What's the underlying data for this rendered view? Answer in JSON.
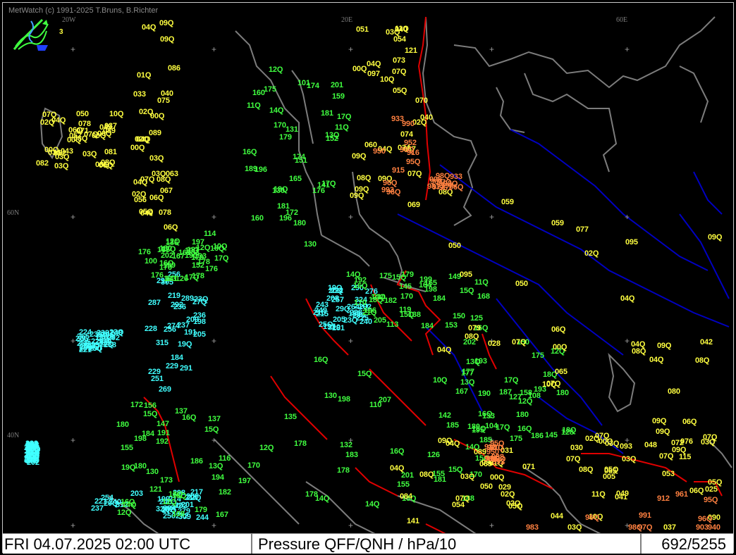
{
  "app": {
    "copyright": "MetWatch  (c) 1991-2025 T.Bruns, B.Richter",
    "logo_number": "3",
    "logo_icon": "metwatch-logo-icon"
  },
  "status": {
    "datetime": "FRI 04.07.2025 02:00 UTC",
    "product": "Pressure QFF/QNH / hPa/10",
    "count": "692/5255"
  },
  "grid_labels": [
    "20W",
    "20E",
    "60E",
    "60N",
    "40N"
  ],
  "colors": {
    "cyan": "#40ffff",
    "green": "#40ff40",
    "yellow": "#ffff40",
    "orange": "#ff8040",
    "coast": "#7c7c7c",
    "border": "#e00000",
    "river": "#0000c0",
    "statusbar": "#ffffff"
  },
  "stations": {
    "cyan": [
      "289",
      "318",
      "324",
      "314",
      "312",
      "291",
      "286",
      "285",
      "290",
      "309",
      "305",
      "297",
      "292",
      "250",
      "272",
      "274",
      "268",
      "257",
      "236",
      "240",
      "251",
      "235",
      "222",
      "202",
      "201",
      "219",
      "221",
      "210",
      "227",
      "237",
      "236",
      "238",
      "249",
      "254",
      "250",
      "256",
      "265",
      "264",
      "263",
      "262",
      "269",
      "270",
      "276",
      "268",
      "279",
      "287",
      "291",
      "290",
      "288",
      "298",
      "297",
      "290",
      "281",
      "295",
      "284",
      "292",
      "226",
      "228",
      "223",
      "214",
      "205",
      "207",
      "197",
      "234",
      "221",
      "237",
      "209",
      "215",
      "216",
      "214",
      "209",
      "202",
      "208",
      "215",
      "199",
      "191",
      "180",
      "180",
      "228",
      "232",
      "229",
      "238",
      "240",
      "253",
      "244",
      "228",
      "224",
      "215",
      "206",
      "203",
      "198",
      "201",
      "205",
      "206",
      "202",
      "184",
      "238",
      "21Q",
      "20Q",
      "32Q",
      "315",
      "24Q",
      "23Q",
      "20Q",
      "20Q",
      "19Q",
      "23Q",
      "20Q",
      "253",
      "254",
      "229",
      "248",
      "225",
      "231",
      "240",
      "256",
      "238",
      "243",
      "226",
      "217",
      "236",
      "23Q",
      "25Q",
      "24Q",
      "27Q",
      "27Q",
      "26Q",
      "29Q",
      "21Q",
      "22Q",
      "23Q",
      "22Q",
      "19Q",
      "19Q",
      "206"
    ],
    "green": [
      "160",
      "133",
      "125",
      "130",
      "130",
      "128",
      "131",
      "114",
      "113",
      "110",
      "108",
      "104",
      "101",
      "100",
      "14Q",
      "14Q",
      "15Q",
      "16Q",
      "165",
      "167",
      "149",
      "142",
      "147",
      "145",
      "152",
      "136",
      "119",
      "126",
      "173",
      "175",
      "174",
      "176",
      "196",
      "197",
      "191",
      "180",
      "170",
      "179",
      "165",
      "132",
      "137",
      "150",
      "141",
      "187",
      "199",
      "198",
      "155",
      "16Q",
      "175",
      "202",
      "210",
      "201",
      "198",
      "186",
      "159",
      "165",
      "168",
      "177",
      "184",
      "193",
      "201",
      "178",
      "21Q",
      "207",
      "16Q",
      "202",
      "196",
      "180",
      "175",
      "170",
      "180",
      "167",
      "12Q",
      "126",
      "150",
      "16Q",
      "19Q",
      "18Q",
      "17Q",
      "16Q",
      "15Q",
      "14Q",
      "16Q",
      "17Q",
      "18Q",
      "17Q",
      "16Q",
      "15Q",
      "13Q",
      "12Q",
      "11Q",
      "10Q",
      "14Q",
      "15Q",
      "16Q",
      "17Q",
      "179",
      "183",
      "184",
      "185",
      "186",
      "187",
      "189",
      "190",
      "192",
      "193",
      "194",
      "195",
      "196",
      "197",
      "198",
      "170",
      "172",
      "175",
      "176",
      "178",
      "179",
      "181",
      "182",
      "185",
      "151",
      "152",
      "153",
      "155",
      "156",
      "158",
      "160",
      "167",
      "170",
      "178",
      "179",
      "180",
      "181",
      "176",
      "182",
      "183",
      "180",
      "177",
      "180",
      "17Q",
      "18Q",
      "16Q",
      "15Q",
      "14Q",
      "13Q",
      "12Q",
      "11Q",
      "10Q",
      "116",
      "108",
      "130",
      "141",
      "145",
      "155",
      "137",
      "127",
      "130",
      "133",
      "138",
      "135",
      "121",
      "133",
      "14Q",
      "12Q",
      "15Q",
      "16Q",
      "12Q",
      "13Q",
      "11Q",
      "10Q",
      "164",
      "178",
      "192",
      "190",
      "181",
      "176",
      "170",
      "188",
      "167",
      "180",
      "174",
      "17Q",
      "16Q",
      "15Q",
      "14Q",
      "18Q",
      "17Q",
      "16Q",
      "15Q",
      "13Q",
      "13Q",
      "12Q",
      "172",
      "176",
      "184",
      "178",
      "12Q",
      "15Q",
      "16Q",
      "199",
      "205",
      "12Q"
    ],
    "yellow": [
      "057",
      "034",
      "050",
      "048",
      "054",
      "049",
      "045",
      "070",
      "042",
      "049",
      "044",
      "056",
      "052",
      "040",
      "059",
      "053",
      "050",
      "040",
      "043",
      "060",
      "059",
      "09Q",
      "092",
      "08Q",
      "089",
      "097",
      "095",
      "093",
      "089",
      "086",
      "08Q",
      "087",
      "07Q",
      "090",
      "084",
      "078",
      "071",
      "074",
      "079",
      "065",
      "069",
      "089",
      "078",
      "054",
      "050",
      "076",
      "029",
      "075",
      "037",
      "069",
      "028",
      "025",
      "041",
      "033",
      "034",
      "040",
      "077",
      "005",
      "030",
      "03Q",
      "081",
      "051",
      "095",
      "11Q",
      "04Q",
      "03Q",
      "02Q",
      "03Q",
      "02Q",
      "03Q",
      "02Q",
      "02Q",
      "03Q",
      "08Q",
      "09Q",
      "07Q",
      "05Q",
      "04Q",
      "04Q",
      "07Q",
      "06Q",
      "02Q",
      "03Q",
      "02Q",
      "07Q",
      "07Q",
      "04Q",
      "05Q",
      "03Q",
      "09Q",
      "07Q",
      "09Q",
      "08Q",
      "06Q",
      "09Q",
      "05Q",
      "10Q",
      "02Q",
      "04Q",
      "07Q",
      "08Q",
      "04Q",
      "06Q",
      "04Q",
      "04Q",
      "03Q",
      "00Q",
      "00Q",
      "06Q",
      "04Q",
      "08Q",
      "00Q",
      "01Q",
      "02Q",
      "03Q",
      "00Q",
      "00Q",
      "09Q",
      "07Q",
      "06Q",
      "00Q",
      "10Q",
      "10Q",
      "09Q",
      "08Q",
      "07Q",
      "06Q",
      "05Q",
      "04Q",
      "03Q",
      "02Q",
      "01Q",
      "00Q",
      "09Q",
      "08Q",
      "07Q",
      "04Q",
      "00Q",
      "00Q",
      "09Q",
      "07Q",
      "06Q",
      "05Q",
      "04Q",
      "03Q",
      "09Q",
      "08Q",
      "072",
      "071",
      "067",
      "082",
      "073",
      "065",
      "037",
      "031",
      "063",
      "050",
      "121",
      "080",
      "115",
      "141",
      "09Q",
      "08Q",
      "11Q",
      "09Q",
      "10Q",
      "07Q",
      "06Q",
      "08Q"
    ],
    "orange": [
      "990",
      "997",
      "960",
      "991",
      "993",
      "961",
      "938",
      "940",
      "915",
      "933",
      "998",
      "903",
      "916",
      "963",
      "920",
      "912",
      "933",
      "981",
      "931",
      "983",
      "950",
      "972",
      "950",
      "98Q",
      "952",
      "006",
      "992",
      "961",
      "96Q",
      "97Q",
      "98Q",
      "96Q",
      "96Q",
      "96Q",
      "95Q",
      "95Q",
      "96Q",
      "98Q",
      "97Q",
      "96Q",
      "95Q",
      "98Q",
      "96Q",
      "97Q"
    ]
  }
}
